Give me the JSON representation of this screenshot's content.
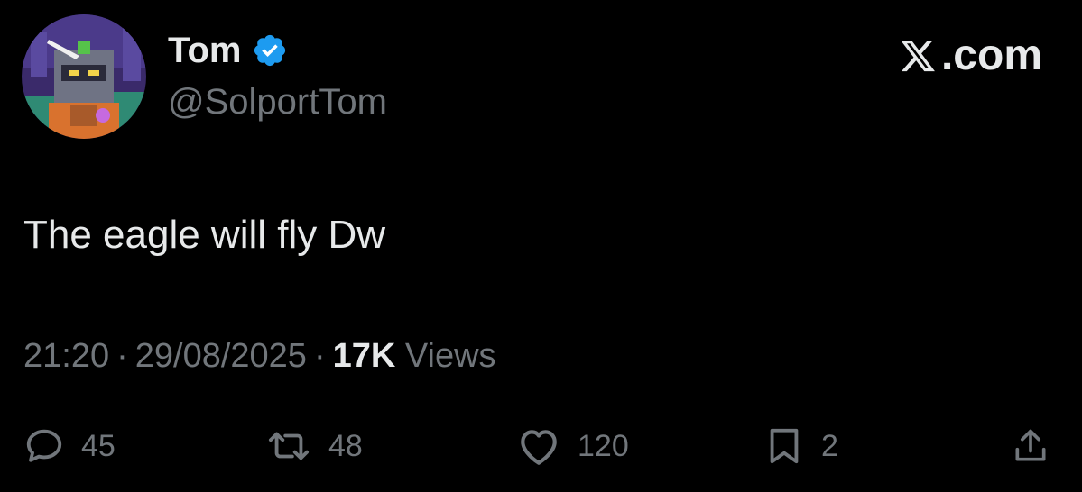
{
  "author": {
    "name": "Tom",
    "handle": "@SolportTom",
    "verified": true,
    "avatar_icon": "robot-avatar"
  },
  "brand": {
    "label": ".com",
    "icon": "x-logo-icon"
  },
  "tweet": {
    "text": "The eagle will fly Dw",
    "time": "21:20",
    "date": "29/08/2025",
    "separator": "·",
    "views_count": "17K",
    "views_label": "Views"
  },
  "actions": {
    "replies": "45",
    "reposts": "48",
    "likes": "120",
    "bookmarks": "2"
  },
  "colors": {
    "background": "#000000",
    "text_primary": "#e7e9ea",
    "text_secondary": "#71767b",
    "verified_blue": "#1d9bf0"
  }
}
